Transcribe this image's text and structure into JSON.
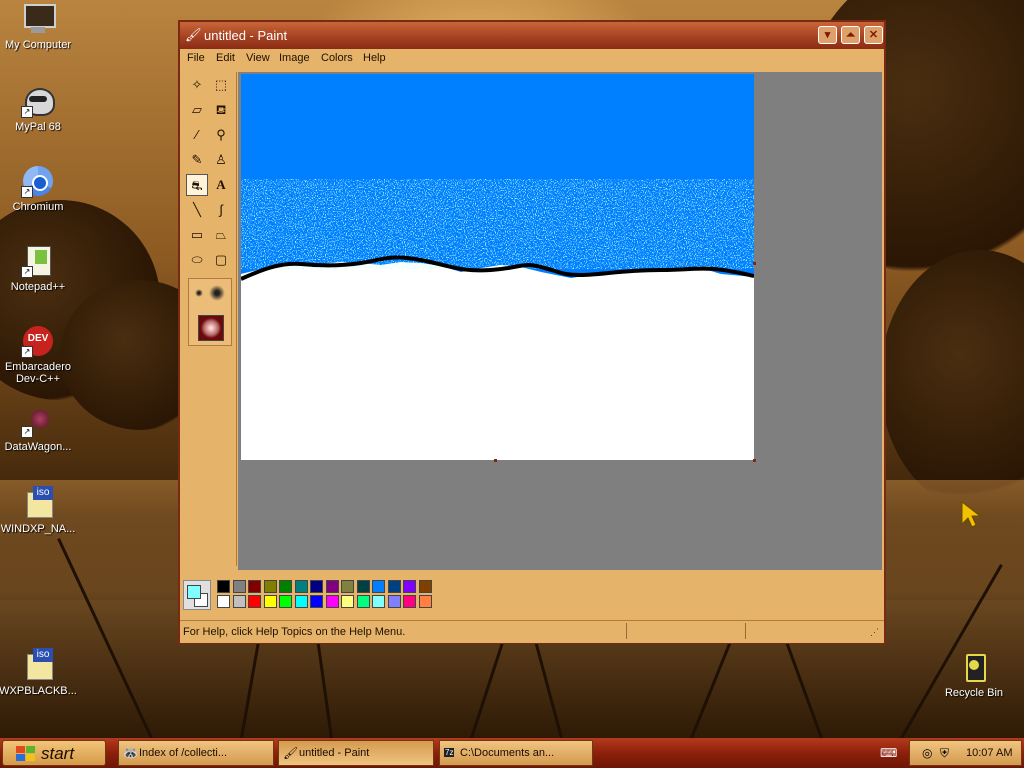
{
  "desktop_icons": [
    {
      "label": "My Computer",
      "icon": "computer-icon"
    },
    {
      "label": "MyPal 68",
      "icon": "mypal-icon"
    },
    {
      "label": "Chromium",
      "icon": "chromium-icon"
    },
    {
      "label": "Notepad++",
      "icon": "notepadpp-icon"
    },
    {
      "label": "Embarcadero Dev-C++",
      "icon": "devcpp-icon",
      "badge": "DEV"
    },
    {
      "label": "DataWagon...",
      "icon": "datawagon-icon"
    },
    {
      "label": "WINDXP_NA...",
      "icon": "iso-file-icon",
      "badge": "iso"
    },
    {
      "label": "WXPBLACKB...",
      "icon": "iso-file-icon",
      "badge": "iso"
    },
    {
      "label": "Recycle Bin",
      "icon": "recycle-bin-icon"
    }
  ],
  "window": {
    "title": "untitled - Paint",
    "menu": [
      "File",
      "Edit",
      "View",
      "Image",
      "Colors",
      "Help"
    ],
    "status_text": "For Help, click Help Topics on the Help Menu.",
    "tools": [
      {
        "name": "free-form-select",
        "glyph": "✧"
      },
      {
        "name": "rect-select",
        "glyph": "⬚"
      },
      {
        "name": "eraser",
        "glyph": "▱"
      },
      {
        "name": "fill",
        "glyph": "⛾"
      },
      {
        "name": "pick-color",
        "glyph": "⁄"
      },
      {
        "name": "magnifier",
        "glyph": "⚲"
      },
      {
        "name": "pencil",
        "glyph": "✎"
      },
      {
        "name": "brush",
        "glyph": "♙"
      },
      {
        "name": "airbrush",
        "glyph": "⛐"
      },
      {
        "name": "text",
        "glyph": "A"
      },
      {
        "name": "line",
        "glyph": "╲"
      },
      {
        "name": "curve",
        "glyph": "∫"
      },
      {
        "name": "rectangle",
        "glyph": "▭"
      },
      {
        "name": "polygon",
        "glyph": "⏢"
      },
      {
        "name": "ellipse",
        "glyph": "⬭"
      },
      {
        "name": "rounded-rect",
        "glyph": "▢"
      }
    ],
    "selected_tool": "airbrush",
    "foreground_color": "#80ffff",
    "background_color": "#ffffff",
    "palette_row1": [
      "#000000",
      "#808080",
      "#800000",
      "#808000",
      "#008000",
      "#008080",
      "#000080",
      "#800080",
      "#808040",
      "#004040",
      "#0080ff",
      "#004080",
      "#8000ff",
      "#804000"
    ],
    "palette_row2": [
      "#ffffff",
      "#c0c0c0",
      "#ff0000",
      "#ffff00",
      "#00ff00",
      "#00ffff",
      "#0000ff",
      "#ff00ff",
      "#ffff80",
      "#00ff80",
      "#80ffff",
      "#8080ff",
      "#ff0080",
      "#ff8040"
    ],
    "canvas_colors": {
      "sky": "#0080ff",
      "snow": "#ffffff",
      "spray": "#80ffff",
      "ridge": "#000000"
    }
  },
  "taskbar": {
    "start_label": "start",
    "tasks": [
      {
        "label": "Index of /collecti...",
        "icon": "browser-icon"
      },
      {
        "label": "untitled - Paint",
        "icon": "paint-icon",
        "active": true
      },
      {
        "label": "C:\\Documents an...",
        "icon": "7zip-icon",
        "badge": "7z"
      }
    ],
    "clock": "10:07 AM"
  }
}
